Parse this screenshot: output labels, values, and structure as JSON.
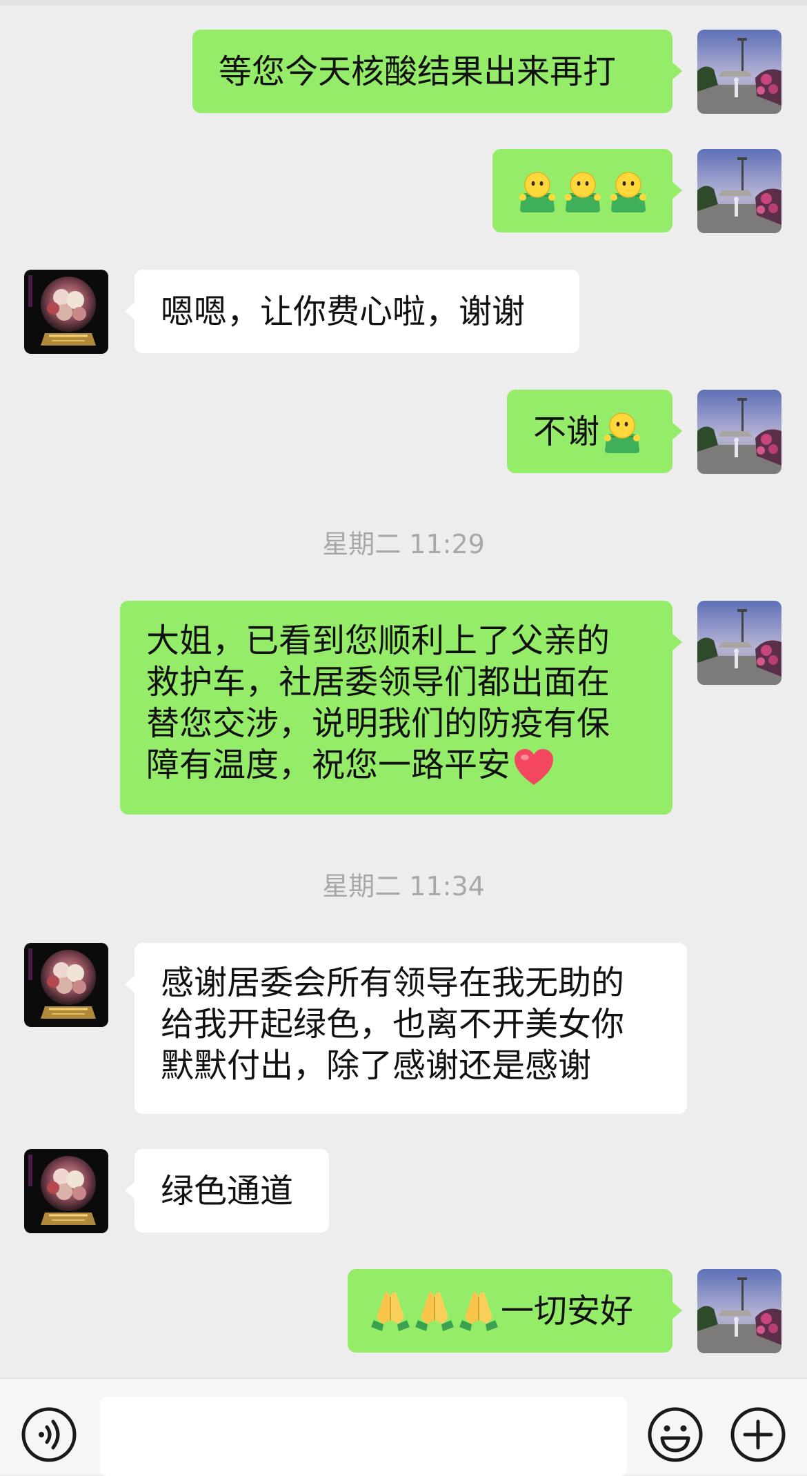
{
  "messages": [
    {
      "side": "me",
      "text": "等您今天核酸结果出来再打"
    },
    {
      "side": "me",
      "emoji": [
        "smiley-bucket-emoji",
        "smiley-bucket-emoji",
        "smiley-bucket-emoji"
      ]
    },
    {
      "side": "them",
      "text": "嗯嗯，让你费心啦，谢谢"
    },
    {
      "side": "me",
      "text": "不谢",
      "emoji": [
        "smiley-bucket-emoji"
      ]
    },
    {
      "side": "me",
      "lines": [
        "大姐，已看到您顺利上了父亲的",
        "救护车，社居委领导们都出面在",
        "替您交涉，说明我们的防疫有保",
        "障有温度，祝您一路平安"
      ],
      "emoji": [
        "heart-emoji"
      ]
    },
    {
      "side": "them",
      "lines": [
        "感谢居委会所有领导在我无助的",
        "给我开起绿色，也离不开美女你",
        "默默付出，除了感谢还是感谢"
      ]
    },
    {
      "side": "them",
      "text": "绿色通道"
    },
    {
      "side": "me",
      "text": "一切安好",
      "emoji": [
        "pray-emoji",
        "pray-emoji",
        "pray-emoji"
      ]
    }
  ],
  "timestamps": [
    "星期二 11:29",
    "星期二 11:34"
  ],
  "input": {
    "value": ""
  },
  "colors": {
    "background": "#ededed",
    "my_bubble": "#95ec69",
    "their_bubble": "#ffffff",
    "timestamp": "#a8a8a8"
  },
  "icons": {
    "left": "voice-icon",
    "right1": "emoji-face-icon",
    "right2": "plus-icon"
  }
}
